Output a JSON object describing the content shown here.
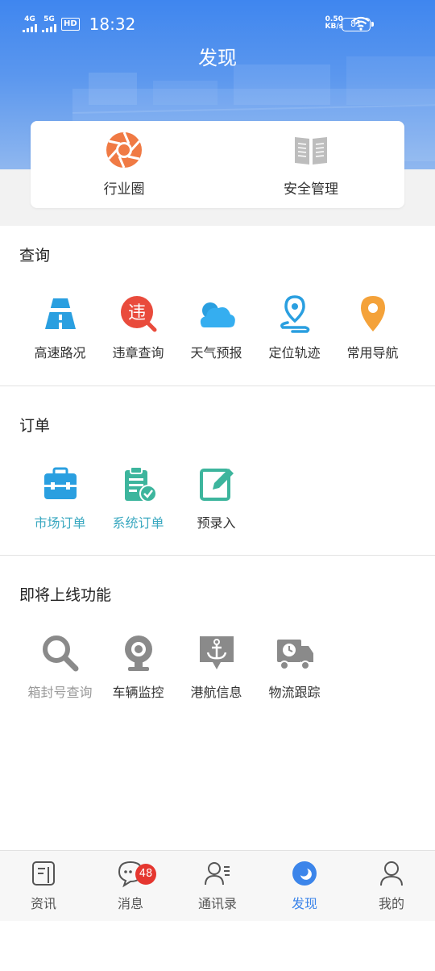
{
  "status_bar": {
    "signal1": "4G",
    "signal2": "5G",
    "hd": "HD",
    "time": "18:32",
    "speed_value": "0.50",
    "speed_unit": "KB/s",
    "battery": "81"
  },
  "header": {
    "title": "发现"
  },
  "quick_actions": [
    {
      "label": "行业圈",
      "icon": "aperture-icon"
    },
    {
      "label": "安全管理",
      "icon": "book-icon"
    }
  ],
  "query_section": {
    "title": "查询",
    "items": [
      {
        "label": "高速路况",
        "icon": "highway-icon"
      },
      {
        "label": "违章查询",
        "icon": "violation-icon",
        "icon_text": "违"
      },
      {
        "label": "天气预报",
        "icon": "cloud-icon"
      },
      {
        "label": "定位轨迹",
        "icon": "location-track-icon"
      },
      {
        "label": "常用导航",
        "icon": "map-pin-icon"
      }
    ]
  },
  "order_section": {
    "title": "订单",
    "items": [
      {
        "label": "市场订单",
        "icon": "briefcase-icon"
      },
      {
        "label": "系统订单",
        "icon": "clipboard-check-icon"
      },
      {
        "label": "预录入",
        "icon": "edit-icon"
      }
    ]
  },
  "upcoming_section": {
    "title": "即将上线功能",
    "items": [
      {
        "label": "箱封号查询",
        "icon": "search-icon"
      },
      {
        "label": "车辆监控",
        "icon": "webcam-icon"
      },
      {
        "label": "港航信息",
        "icon": "anchor-message-icon"
      },
      {
        "label": "物流跟踪",
        "icon": "truck-clock-icon"
      }
    ]
  },
  "tabbar": {
    "tabs": [
      {
        "label": "资讯",
        "icon": "news-icon"
      },
      {
        "label": "消息",
        "icon": "chat-icon",
        "badge": "48"
      },
      {
        "label": "通讯录",
        "icon": "contacts-icon"
      },
      {
        "label": "发现",
        "icon": "discover-icon",
        "active": true
      },
      {
        "label": "我的",
        "icon": "profile-icon"
      }
    ]
  },
  "colors": {
    "accent": "#3c85ea",
    "teal": "#3aa8c0",
    "badge": "#e5362f"
  }
}
